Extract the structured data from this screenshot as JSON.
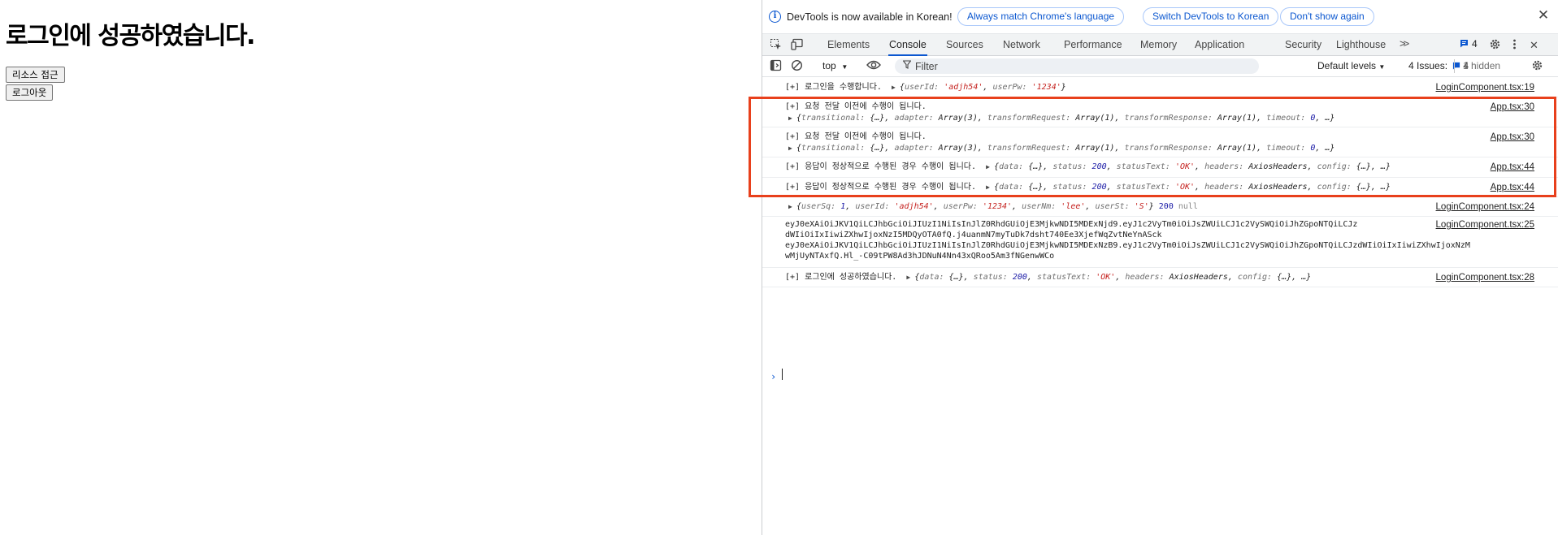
{
  "page": {
    "heading": "로그인에 성공하였습니다.",
    "resource_button": "리소스 접근",
    "logout_button": "로그아웃"
  },
  "devtools": {
    "infobar": {
      "message": "DevTools is now available in Korean!",
      "btn_match": "Always match Chrome's language",
      "btn_switch": "Switch DevTools to Korean",
      "btn_dismiss": "Don't show again"
    },
    "tabs": [
      {
        "label": "Elements"
      },
      {
        "label": "Console"
      },
      {
        "label": "Sources"
      },
      {
        "label": "Network"
      },
      {
        "label": "Performance"
      },
      {
        "label": "Memory"
      },
      {
        "label": "Application"
      },
      {
        "label": "Security"
      },
      {
        "label": "Lighthouse"
      }
    ],
    "active_tab": "Console",
    "issues_badge": "4",
    "toolbar": {
      "context": "top",
      "filter_placeholder": "Filter",
      "levels": "Default levels",
      "issues_label": "4 Issues:",
      "issues_num": "4",
      "hidden": "1 hidden"
    },
    "rows": [
      {
        "prefix": "[+] 로그인을 수행합니다.",
        "src": "LoginComponent.tsx:19"
      },
      {
        "prefix": "[+] 요청 전달 이전에 수행이 됩니다.",
        "src": "App.tsx:30"
      },
      {
        "prefix": "[+] 요청 전달 이전에 수행이 됩니다.",
        "src": "App.tsx:30"
      },
      {
        "prefix": "[+] 응답이 정상적으로 수행된 경우 수행이 됩니다.",
        "src": "App.tsx:44"
      },
      {
        "prefix": "[+] 응답이 정상적으로 수행된 경우 수행이 됩니다.",
        "src": "App.tsx:44"
      },
      {
        "prefix": "",
        "src": "LoginComponent.tsx:24"
      },
      {
        "token_lines": [
          "eyJ0eXAiOiJKV1QiLCJhbGciOiJIUzI1NiIsInJlZ0RhdGUiOjE3MjkwNDI5MDExNjd9.eyJ1c2VyTm0iOiJsZWUiLCJ1c2VySWQiOiJhZGpoNTQiLCJz",
          "dWIiOiIxIiwiZXhwIjoxNzI5MDQyOTA0fQ.j4uanmN7myTuDk7dsht740Ee3XjefWqZvtNeYnASck",
          "eyJ0eXAiOiJKV1QiLCJhbGciOiJIUzI1NiIsInJlZ0RhdGUiOjE3MjkwNDI5MDExNzB9.eyJ1c2VyTm0iOiJsZWUiLCJ1c2VySWQiOiJhZGpoNTQiLCJzdWIiOiIxIiwiZXhwIjoxNzM",
          "wMjUyNTAxfQ.Hl_-C09tPW8Ad3hJDNuN4Nn43xQRoo5Am3fNGenwWCo"
        ],
        "src": "LoginComponent.tsx:25"
      },
      {
        "prefix": "[+] 로그인에 성공하였습니다.",
        "src": "LoginComponent.tsx:28"
      }
    ],
    "row1_obj": {
      "k1": "userId:",
      "v1": "'adjh54'",
      "k2": "userPw:",
      "v2": "'1234'"
    },
    "req_obj": {
      "k1": "transitional:",
      "v1": "{…},",
      "k2": "adapter:",
      "v2": "Array(3),",
      "k3": "transformRequest:",
      "v3": "Array(1),",
      "k4": "transformResponse:",
      "v4": "Array(1),",
      "k5": "timeout:",
      "v5": "0",
      "tail": ", …}"
    },
    "res_obj": {
      "k1": "data:",
      "v1": "{…},",
      "k2": "status:",
      "v2": "200",
      "k3": "statusText:",
      "v3": "'OK'",
      "k4": "headers:",
      "v4": "AxiosHeaders,",
      "k5": "config:",
      "v5": "{…},",
      "tail": "…}"
    },
    "user_obj": {
      "k1": "userSq:",
      "v1": "1",
      "k2": "userId:",
      "v2": "'adjh54'",
      "k3": "userPw:",
      "v3": "'1234'",
      "k4": "userNm:",
      "v4": "'lee'",
      "k5": "userSt:",
      "v5": "'S'",
      "status": "200",
      "nullv": "null"
    },
    "colors": {
      "accent": "#0b57d0",
      "highlight": "#e8401c",
      "string": "#c5221f",
      "number": "#1a1aa6"
    }
  }
}
